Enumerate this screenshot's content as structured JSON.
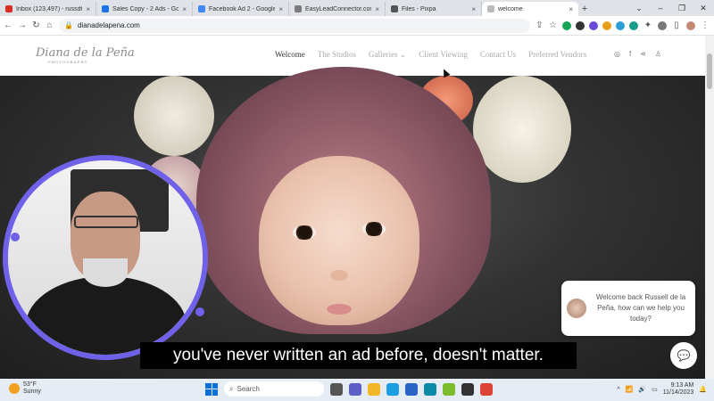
{
  "browser": {
    "tabs": [
      {
        "title": "Inbox (123,497) - russdtpl...",
        "icon": "gmail-icon",
        "color": "#d93025",
        "active": false
      },
      {
        "title": "Sales Copy - 2 Ads - Goog...",
        "icon": "drive-icon",
        "color": "#1a73e8",
        "active": false
      },
      {
        "title": "Facebook Ad 2 - Google D...",
        "icon": "docs-icon",
        "color": "#4285f4",
        "active": false
      },
      {
        "title": "EasyLeadConnector.com",
        "icon": "site-icon",
        "color": "#7b7b7b",
        "active": false
      },
      {
        "title": "Files - Pixpa",
        "icon": "pixpa-icon",
        "color": "#555555",
        "active": false
      },
      {
        "title": "welcome",
        "icon": "site-icon",
        "color": "#bbbbbb",
        "active": true
      }
    ],
    "url": "dianadelapena.com"
  },
  "site": {
    "logo": "Diana de la Peña",
    "logo_sub": "PHOTOGRAPHY",
    "nav": [
      "Welcome",
      "The Studios",
      "Galleries",
      "Client Viewing",
      "Contact Us",
      "Preferred Vendors"
    ],
    "chat_message": "Welcome back Russell de la Peña, how can we help you today?"
  },
  "caption": "you've never written an ad before, doesn't matter.",
  "taskbar": {
    "temp": "53°F",
    "weather": "Sunny",
    "search_placeholder": "Search",
    "time": "9:13 AM",
    "date": "11/14/2023"
  },
  "colors": {
    "accent": "#6f61e8"
  }
}
